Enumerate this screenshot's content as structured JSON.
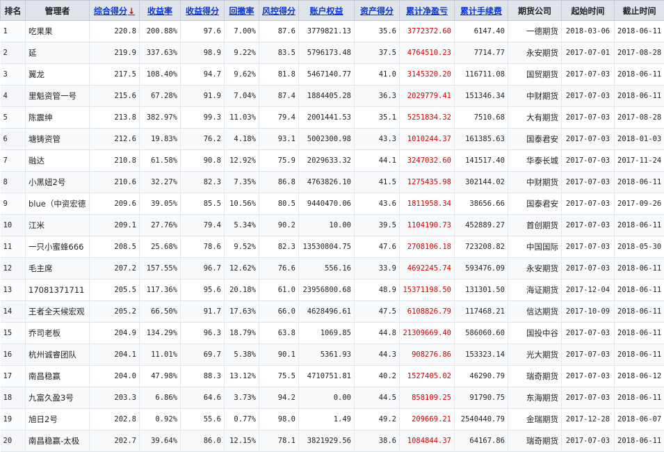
{
  "headers": [
    "排名",
    "管理者",
    "综合得分",
    "收益率",
    "收益得分",
    "回撤率",
    "风控得分",
    "账户权益",
    "资产得分",
    "累计净盈亏",
    "累计手续费",
    "期货公司",
    "起始时间",
    "截止时间"
  ],
  "sort_indicator": "↓",
  "rows": [
    [
      "1",
      "吃果果",
      "220.8",
      "200.88%",
      "97.6",
      "7.00%",
      "87.6",
      "3779821.13",
      "35.6",
      "3772372.60",
      "6147.40",
      "一德期货",
      "2018-03-06",
      "2018-06-11"
    ],
    [
      "2",
      "延",
      "219.9",
      "337.63%",
      "98.9",
      "9.22%",
      "83.5",
      "5796173.48",
      "37.5",
      "4764510.23",
      "7714.77",
      "永安期货",
      "2017-07-01",
      "2017-08-28"
    ],
    [
      "3",
      "翼龙",
      "217.5",
      "108.40%",
      "94.7",
      "9.62%",
      "81.8",
      "5467140.77",
      "41.0",
      "3145320.20",
      "116711.08",
      "国贸期货",
      "2017-07-03",
      "2018-06-11"
    ],
    [
      "4",
      "里魁资管一号",
      "215.6",
      "67.28%",
      "91.9",
      "7.04%",
      "87.4",
      "1884405.28",
      "36.3",
      "2029779.41",
      "151346.34",
      "中财期货",
      "2017-07-03",
      "2018-06-11"
    ],
    [
      "5",
      "陈震绅",
      "213.8",
      "382.97%",
      "99.3",
      "11.03%",
      "79.4",
      "2001441.53",
      "35.1",
      "5251834.32",
      "7510.68",
      "大有期货",
      "2017-07-03",
      "2017-08-28"
    ],
    [
      "6",
      "塘铸资管",
      "212.6",
      "19.83%",
      "76.2",
      "4.18%",
      "93.1",
      "5002300.98",
      "43.3",
      "1010244.37",
      "161385.63",
      "国泰君安",
      "2017-07-03",
      "2018-01-03"
    ],
    [
      "7",
      "融达",
      "210.8",
      "61.58%",
      "90.8",
      "12.92%",
      "75.9",
      "2029633.32",
      "44.1",
      "3247032.60",
      "141517.40",
      "华泰长城",
      "2017-07-03",
      "2017-11-24"
    ],
    [
      "8",
      "小黑妞2号",
      "210.6",
      "32.27%",
      "82.3",
      "7.35%",
      "86.8",
      "4763826.10",
      "41.5",
      "1275435.98",
      "302144.02",
      "中财期货",
      "2017-07-03",
      "2018-06-11"
    ],
    [
      "9",
      "blue（中资宏德",
      "209.6",
      "39.05%",
      "85.5",
      "10.56%",
      "80.5",
      "9440470.06",
      "43.6",
      "1811958.34",
      "38656.66",
      "国泰君安",
      "2017-07-03",
      "2017-09-26"
    ],
    [
      "10",
      "江米",
      "209.1",
      "27.76%",
      "79.4",
      "5.34%",
      "90.2",
      "10.00",
      "39.5",
      "1104190.73",
      "452889.27",
      "首创期货",
      "2017-07-03",
      "2018-06-11"
    ],
    [
      "11",
      "一只小蜜蜂666",
      "208.5",
      "25.68%",
      "78.6",
      "9.52%",
      "82.3",
      "13530804.75",
      "47.6",
      "2708106.18",
      "723208.82",
      "中国国际",
      "2017-07-03",
      "2018-05-30"
    ],
    [
      "12",
      "毛主席",
      "207.2",
      "157.55%",
      "96.7",
      "12.62%",
      "76.6",
      "556.16",
      "33.9",
      "4692245.74",
      "593476.09",
      "永安期货",
      "2017-07-03",
      "2018-06-11"
    ],
    [
      "13",
      "17081371711",
      "205.5",
      "117.36%",
      "95.6",
      "20.18%",
      "61.0",
      "23956800.68",
      "48.9",
      "15371198.50",
      "131301.50",
      "海证期货",
      "2017-12-04",
      "2018-06-11"
    ],
    [
      "14",
      "王者全天候宏观",
      "205.2",
      "66.50%",
      "91.7",
      "17.63%",
      "66.0",
      "4628496.61",
      "47.5",
      "6108826.79",
      "117468.21",
      "信达期货",
      "2017-10-09",
      "2018-06-11"
    ],
    [
      "15",
      "乔司老板",
      "204.9",
      "134.29%",
      "96.3",
      "18.79%",
      "63.8",
      "1069.85",
      "44.8",
      "21309669.40",
      "586060.60",
      "国投中谷",
      "2017-07-03",
      "2018-06-11"
    ],
    [
      "16",
      "杭州诚睿团队",
      "204.1",
      "11.01%",
      "69.7",
      "5.38%",
      "90.1",
      "5361.93",
      "44.3",
      "908276.86",
      "153323.14",
      "光大期货",
      "2017-07-03",
      "2018-06-11"
    ],
    [
      "17",
      "南昌稳赢",
      "204.0",
      "47.98%",
      "88.3",
      "13.12%",
      "75.5",
      "4710751.81",
      "40.2",
      "1527405.02",
      "46290.79",
      "瑞奇期货",
      "2017-07-03",
      "2018-06-12"
    ],
    [
      "18",
      "九富久盈3号",
      "203.3",
      "6.86%",
      "64.6",
      "3.73%",
      "94.2",
      "0.00",
      "44.5",
      "858109.25",
      "91790.75",
      "东海期货",
      "2017-07-03",
      "2018-06-11"
    ],
    [
      "19",
      "旭日2号",
      "202.8",
      "0.92%",
      "55.6",
      "0.77%",
      "98.0",
      "1.49",
      "49.2",
      "209669.21",
      "2540440.79",
      "金瑞期货",
      "2017-12-28",
      "2018-06-07"
    ],
    [
      "20",
      "南昌稳赢-太极",
      "202.7",
      "39.64%",
      "86.0",
      "12.15%",
      "78.1",
      "3821929.56",
      "38.6",
      "1084844.37",
      "64167.86",
      "瑞奇期货",
      "2017-07-03",
      "2018-06-11"
    ]
  ]
}
